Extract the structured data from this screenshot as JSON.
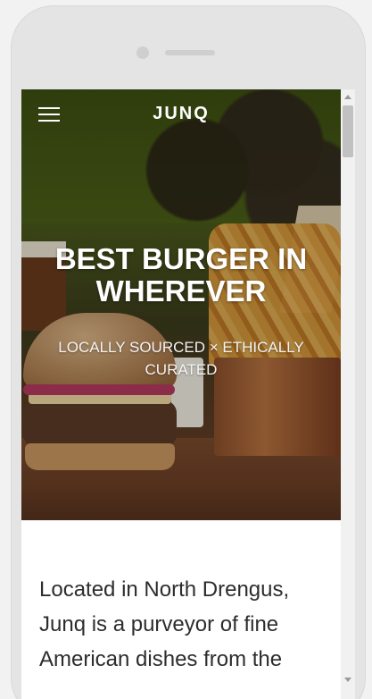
{
  "device": {
    "camera_icon": "camera-icon",
    "speaker_icon": "speaker-icon"
  },
  "header": {
    "menu_icon": "hamburger-menu-icon",
    "brand": "JUNQ"
  },
  "hero": {
    "headline": "BEST BURGER IN WHEREVER",
    "tagline": "LOCALLY SOURCED × ETHICALLY CURATED"
  },
  "intro": {
    "text": "Located in North Drengus, Junq is a purveyor of fine American dishes from the"
  },
  "scrollbar": {
    "up_icon": "scroll-up-arrow-icon",
    "down_icon": "scroll-down-arrow-icon"
  }
}
